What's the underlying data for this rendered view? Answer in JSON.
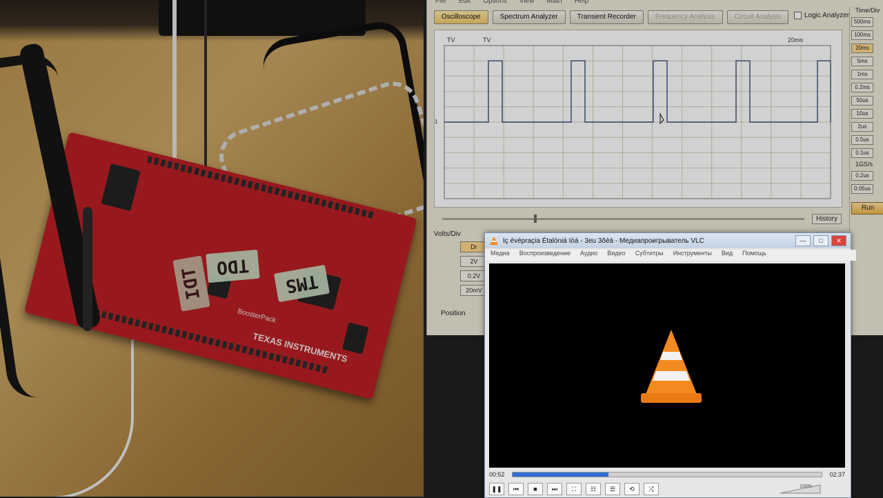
{
  "scope": {
    "menu": [
      "File",
      "Edit",
      "Options",
      "View",
      "Math",
      "Help"
    ],
    "tabs": [
      {
        "label": "Oscilloscope",
        "state": "active"
      },
      {
        "label": "Spectrum Analyzer",
        "state": "normal"
      },
      {
        "label": "Transient Recorder",
        "state": "normal"
      },
      {
        "label": "Frequency Analysis",
        "state": "disabled"
      },
      {
        "label": "Circuit Analysis",
        "state": "disabled"
      }
    ],
    "logic_label": "Logic Analyzer",
    "plot": {
      "tl1": "TV",
      "tl2": "TV",
      "tr": "20ms",
      "marker": "1"
    },
    "history_label": "History",
    "volts_title": "Volts/Div",
    "volts_buttons": [
      "2V",
      "0.2V",
      "20mV"
    ],
    "volts_top": "Dr",
    "position_label": "Position",
    "time_title": "Time/Div",
    "time_buttons": [
      "500ms",
      "100ms",
      "20ms",
      "5ms",
      "1ms",
      "0.2ms",
      "50us",
      "10us",
      "2us",
      "0.5us",
      "0.1us"
    ],
    "time_extra": "1GS/s",
    "time_buttons2": [
      "0.2us",
      "0.05us"
    ],
    "run_label": "Run",
    "colors": {
      "trace": "#3a4a7a",
      "grid": "#cfd3b8",
      "accent": "#f2c96a"
    }
  },
  "vlc": {
    "title": "Iç évépraçia Étalòniá Iòà - 3eu 3ôèà - Медиапроигрыватель VLC",
    "menu": [
      "Медиа",
      "Воспроизведение",
      "Аудио",
      "Видео",
      "Субтитры",
      "Инструменты",
      "Вид",
      "Помощь"
    ],
    "time_current": "00:52",
    "time_total": "02:37",
    "progress": 0.31,
    "volume": "100%"
  },
  "photo": {
    "tags": [
      "TDO",
      "TMS",
      "TDI"
    ],
    "board_text": "TEXAS INSTRUMENTS",
    "board_text2": "BoosterPack"
  }
}
